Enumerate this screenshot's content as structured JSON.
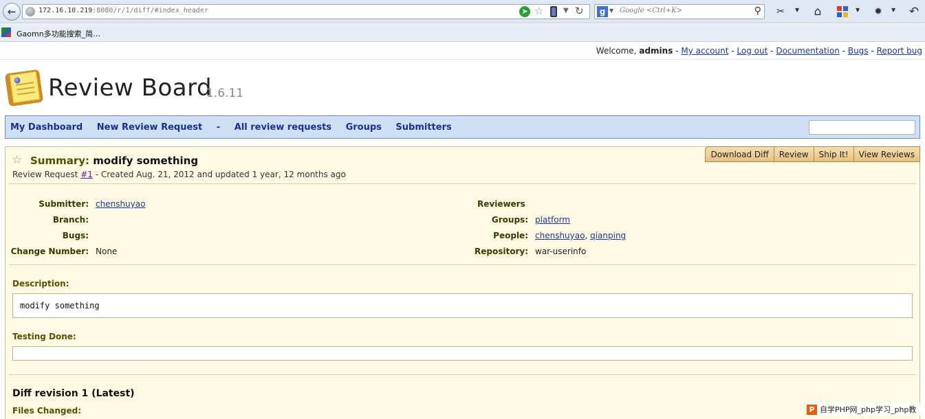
{
  "browser": {
    "url_host": "172.16.10.219",
    "url_path": ":8080/r/1/diff/#index_header",
    "search_placeholder": "Google <Ctrl+K>",
    "bookmark_label": "Gaomn多功能搜索_简…"
  },
  "account": {
    "welcome_prefix": "Welcome,",
    "username": "admins",
    "links": [
      "My account",
      "Log out",
      "Documentation",
      "Bugs",
      "Report bug"
    ]
  },
  "brand": {
    "title": "Review Board",
    "version": "1.6.11"
  },
  "nav": {
    "items": [
      "My Dashboard",
      "New Review Request",
      "All review requests",
      "Groups",
      "Submitters"
    ],
    "separator": "-"
  },
  "actions": [
    "Download Diff",
    "Review",
    "Ship It!",
    "View Reviews"
  ],
  "review": {
    "summary_label": "Summary:",
    "summary_value": "modify something",
    "meta_prefix": "Review Request",
    "meta_id": "#1",
    "meta_suffix": "- Created Aug. 21, 2012 and updated 1 year, 12 months ago",
    "fields_left": [
      {
        "label": "Submitter:",
        "value": "chenshuyao",
        "link": true
      },
      {
        "label": "Branch:",
        "value": ""
      },
      {
        "label": "Bugs:",
        "value": ""
      },
      {
        "label": "Change Number:",
        "value": "None",
        "link": false
      }
    ],
    "reviewers_heading": "Reviewers",
    "fields_right": [
      {
        "label": "Groups:",
        "value": "platform",
        "link": true
      },
      {
        "label": "People:",
        "values": [
          "chenshuyao",
          "qianping"
        ],
        "link": true
      },
      {
        "label": "Repository:",
        "value": "war-userinfo",
        "link": false
      }
    ],
    "description_label": "Description:",
    "description_text": "modify something",
    "testing_label": "Testing Done:",
    "testing_text": "",
    "diff_heading": "Diff revision 1 (Latest)",
    "files_changed_label": "Files Changed:"
  },
  "watermark": {
    "icon": "P",
    "text": "自学PHP网_php学习_php教"
  }
}
